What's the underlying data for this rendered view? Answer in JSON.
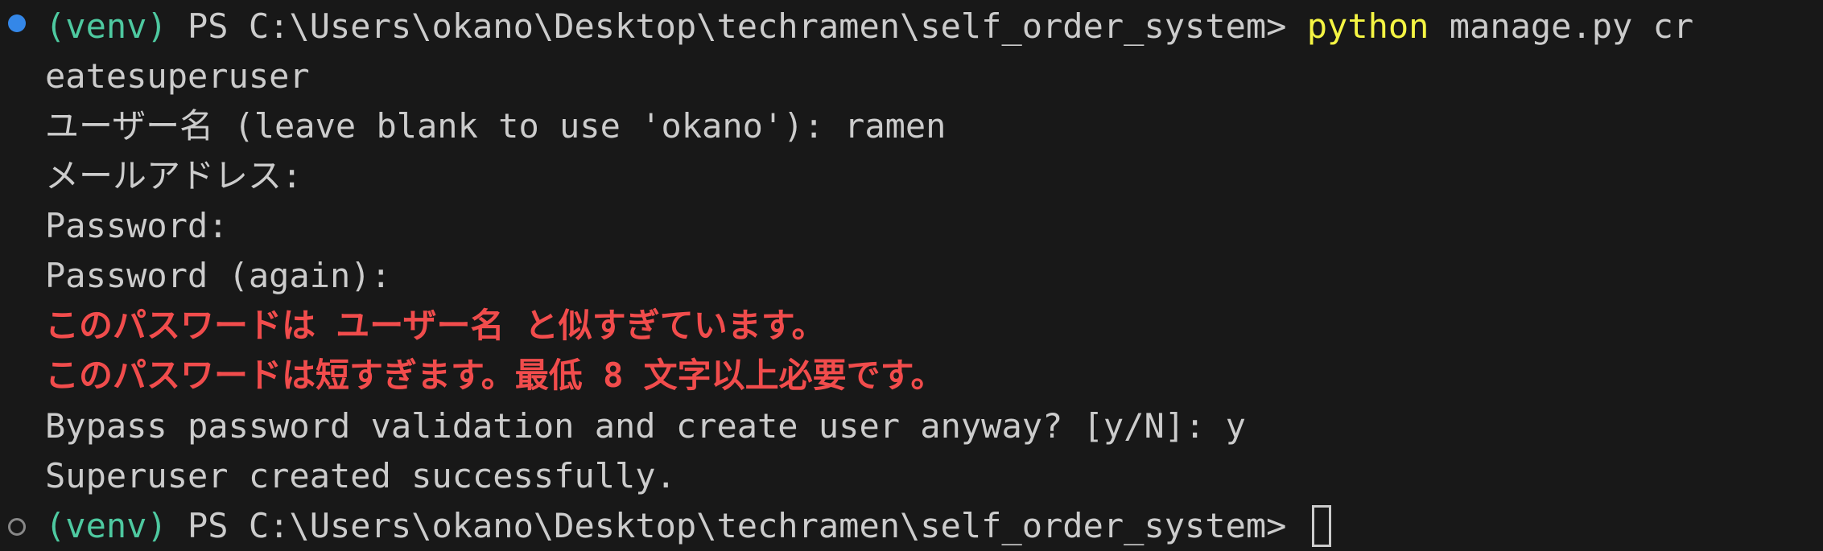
{
  "prompt1": {
    "venv": "(venv)",
    "ps": " PS C:\\Users\\okano\\Desktop\\techramen\\self_order_system> ",
    "command_keyword": "python",
    "command_rest": " manage.py cr"
  },
  "line2": "eatesuperuser",
  "username_prompt": "ユーザー名 (leave blank to use 'okano'): ramen",
  "email_prompt": "メールアドレス:",
  "password_prompt": "Password:",
  "password_again_prompt": "Password (again):",
  "errors": [
    "このパスワードは ユーザー名 と似すぎています。",
    "このパスワードは短すぎます。最低 8 文字以上必要です。"
  ],
  "bypass_prompt": "Bypass password validation and create user anyway? [y/N]: y",
  "success_message": "Superuser created successfully.",
  "prompt2": {
    "venv": "(venv)",
    "ps": " PS C:\\Users\\okano\\Desktop\\techramen\\self_order_system> "
  },
  "colors": {
    "background": "#181818",
    "foreground": "#cccccc",
    "venv": "#4ec9a0",
    "command_keyword": "#f5f543",
    "error": "#f14c4c",
    "decoration_success": "#3794ff"
  },
  "icons": {
    "command_decoration_success": "filled-circle",
    "command_decoration_default": "hollow-circle"
  }
}
